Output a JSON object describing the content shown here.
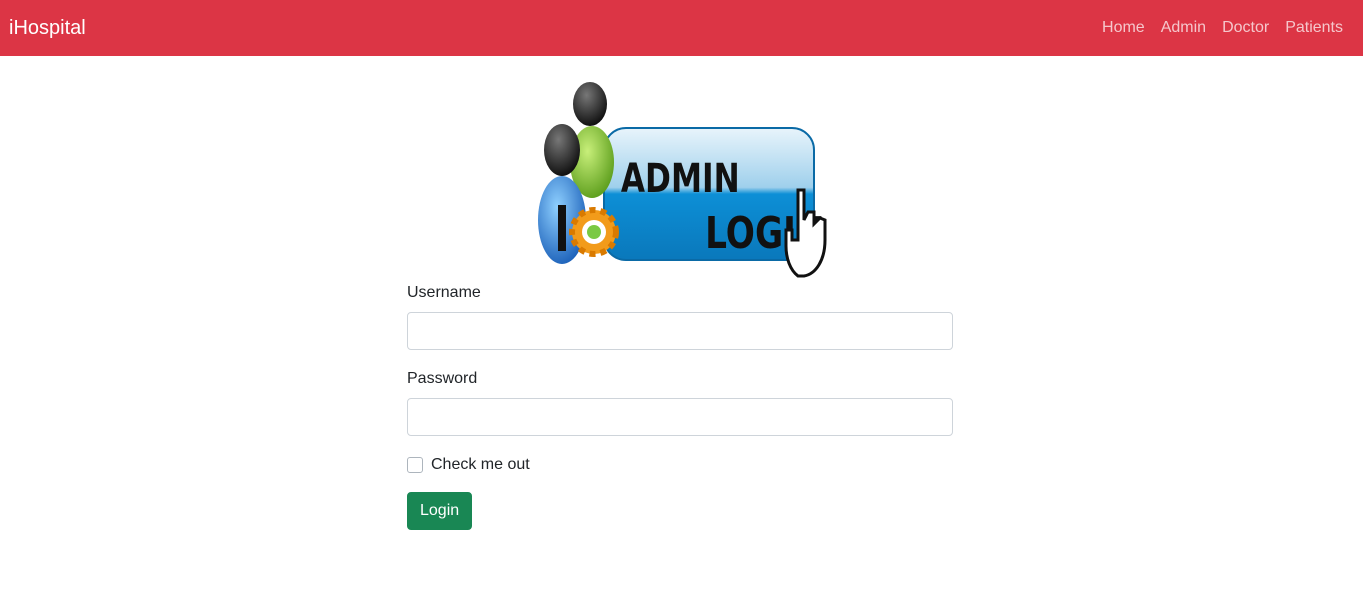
{
  "navbar": {
    "brand": "iHospital",
    "links": [
      "Home",
      "Admin",
      "Doctor",
      "Patients"
    ],
    "background": "#dc3545"
  },
  "logo": {
    "line1": "ADMIN",
    "line2": "LOGIN",
    "accent": "#0d8fd6"
  },
  "form": {
    "username_label": "Username",
    "username_value": "",
    "password_label": "Password",
    "password_value": "",
    "checkbox_label": "Check me out",
    "checkbox_checked": false,
    "submit_label": "Login",
    "submit_color": "#198754"
  }
}
